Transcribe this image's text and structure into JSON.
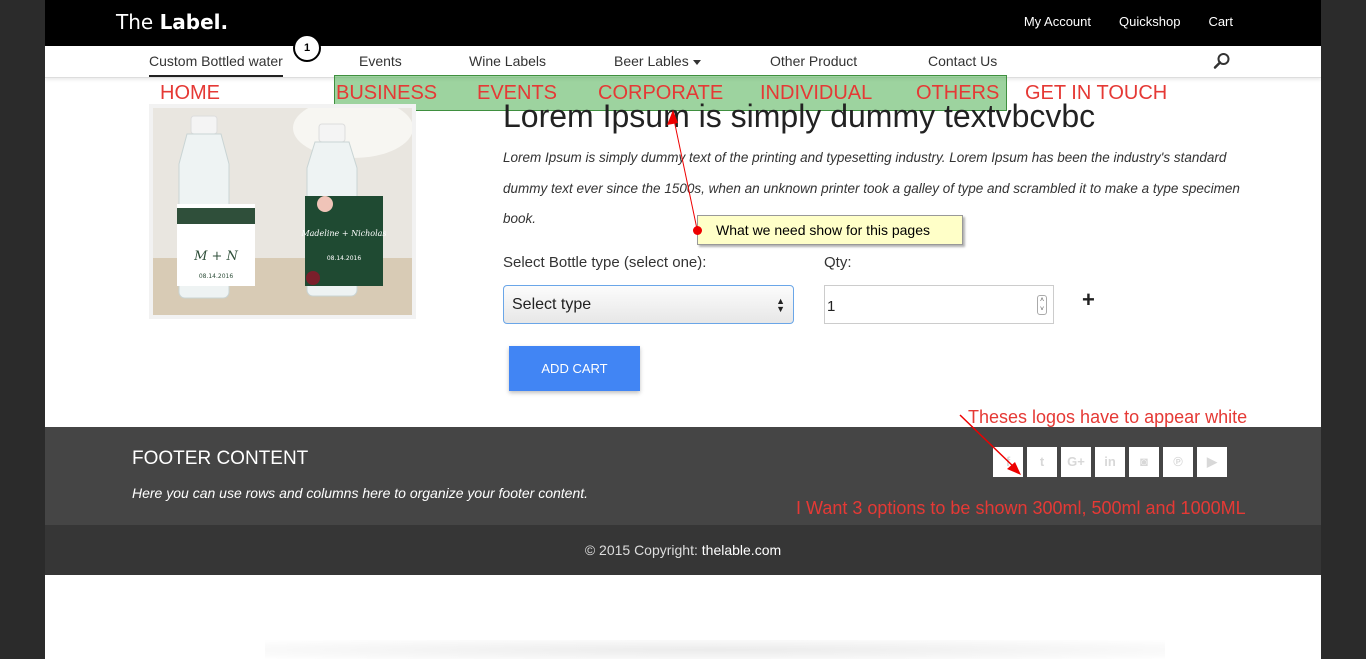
{
  "header": {
    "brand_light": "The ",
    "brand_bold": "Label.",
    "links": [
      "My Account",
      "Quickshop",
      "Cart"
    ]
  },
  "nav": {
    "items": [
      "Custom Bottled water",
      "Events",
      "Wine Labels",
      "Beer Lables",
      "Other Product",
      "Contact Us"
    ],
    "active": "Custom Bottled water",
    "marker_number": "1"
  },
  "annotation_nav": [
    "HOME",
    "BUSINESS",
    "EVENTS",
    "CORPORATE",
    "INDIVIDUAL",
    "OTHERS",
    "GET IN TOUCH"
  ],
  "product": {
    "title": "Lorem Ipsum is simply dummy textvbcvbc",
    "description": "Lorem Ipsum is simply dummy text of the printing and typesetting industry. Lorem Ipsum has been the industry's standard dummy text ever since the 1500s, when an unknown printer took a galley of type and scrambled it to make a type specimen book.",
    "bottle_label": "Select Bottle type (select one):",
    "qty_label": "Qty:",
    "select_value": "Select type",
    "qty_value": "1",
    "add_cart": "ADD CART",
    "image_text": {
      "left_monogram": "M + N",
      "left_date": "08.14.2016",
      "right_names": "Madeline + Nicholas",
      "right_date": "08.14.2016"
    }
  },
  "callout": "What we need show for this pages",
  "footer": {
    "title": "FOOTER CONTENT",
    "text": "Here you can use rows and columns here to organize your footer content.",
    "social_icons": [
      "facebook-icon",
      "twitter-icon",
      "google-plus-icon",
      "linkedin-icon",
      "instagram-icon",
      "pinterest-icon",
      "youtube-icon"
    ],
    "social_glyphs": [
      "f",
      "t",
      "G+",
      "in",
      "◙",
      "℗",
      "▶"
    ],
    "copyright_prefix": "© 2015 Copyright: ",
    "copyright_site": "thelable.com"
  },
  "notes": {
    "logos": "Theses logos have to appear white",
    "options": "I Want 3 options to be shown 300ml, 500ml  and 1000ML"
  },
  "colors": {
    "annotation_red": "#e53935",
    "button_blue": "#4185f4",
    "highlight_green": "#4caf50"
  }
}
